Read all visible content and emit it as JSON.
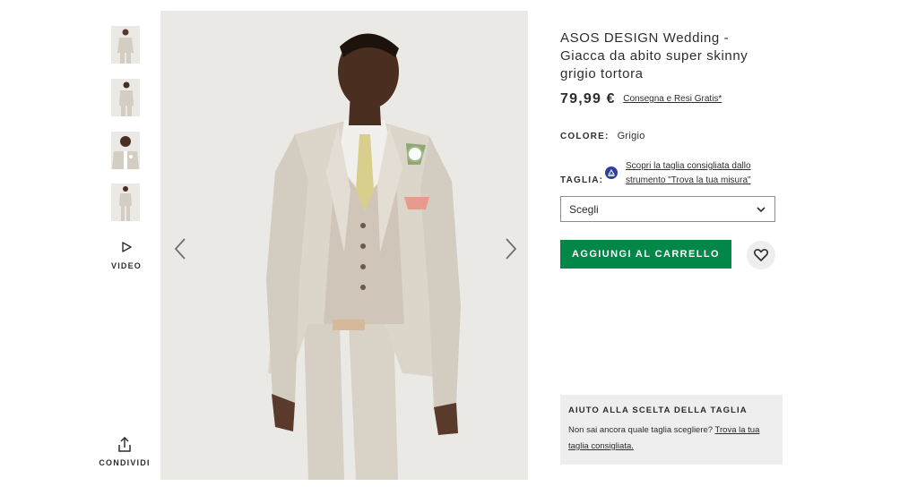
{
  "gallery": {
    "thumbnails": [
      {
        "alt": "thumbnail-1"
      },
      {
        "alt": "thumbnail-2"
      },
      {
        "alt": "thumbnail-3"
      },
      {
        "alt": "thumbnail-4"
      }
    ],
    "video_label": "VIDEO",
    "share_label": "CONDIVIDI"
  },
  "product": {
    "title": "ASOS DESIGN Wedding - Giacca da abito super skinny grigio tortora",
    "price": "79,99 €",
    "delivery_link": "Consegna e Resi Gratis*",
    "color_label": "COLORE:",
    "color_value": "Grigio",
    "size_label": "TAGLIA:",
    "size_guide_link": "Scopri la taglia consigliata dallo strumento \"Trova la tua misura\"",
    "size_select_value": "Scegli",
    "add_to_bag": "AGGIUNGI AL CARRELLO"
  },
  "size_help": {
    "title": "AIUTO ALLA SCELTA DELLA TAGLIA",
    "text": "Non sai ancora quale taglia scegliere? ",
    "link": "Trova la tua taglia consigliata."
  },
  "colors": {
    "accent_green": "#018849",
    "text": "#2d2d2d",
    "panel_bg": "#eeeeee",
    "image_bg": "#ebe9e6",
    "suit": "#d9d2c7"
  }
}
